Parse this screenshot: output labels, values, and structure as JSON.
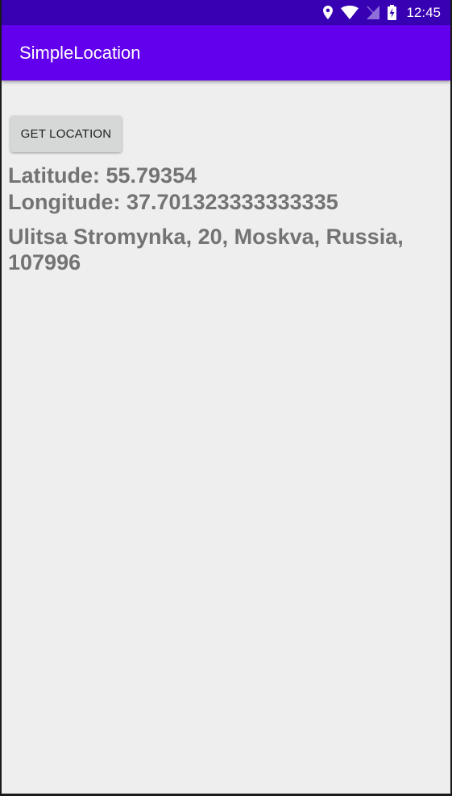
{
  "status_bar": {
    "time": "12:45",
    "icons": [
      "location-pin-icon",
      "wifi-icon",
      "no-sim-icon",
      "battery-charging-icon"
    ]
  },
  "app_bar": {
    "title": "SimpleLocation"
  },
  "main": {
    "button_label": "GET LOCATION",
    "latitude": "Latitude: 55.79354",
    "longitude": "Longitude: 37.701323333333335",
    "address": "Ulitsa Stromynka, 20, Moskva, Russia, 107996"
  },
  "colors": {
    "status_bar": "#3700b3",
    "app_bar": "#6200ee",
    "background": "#eeeeee",
    "text": "#737373",
    "button": "#d6d7d7"
  }
}
